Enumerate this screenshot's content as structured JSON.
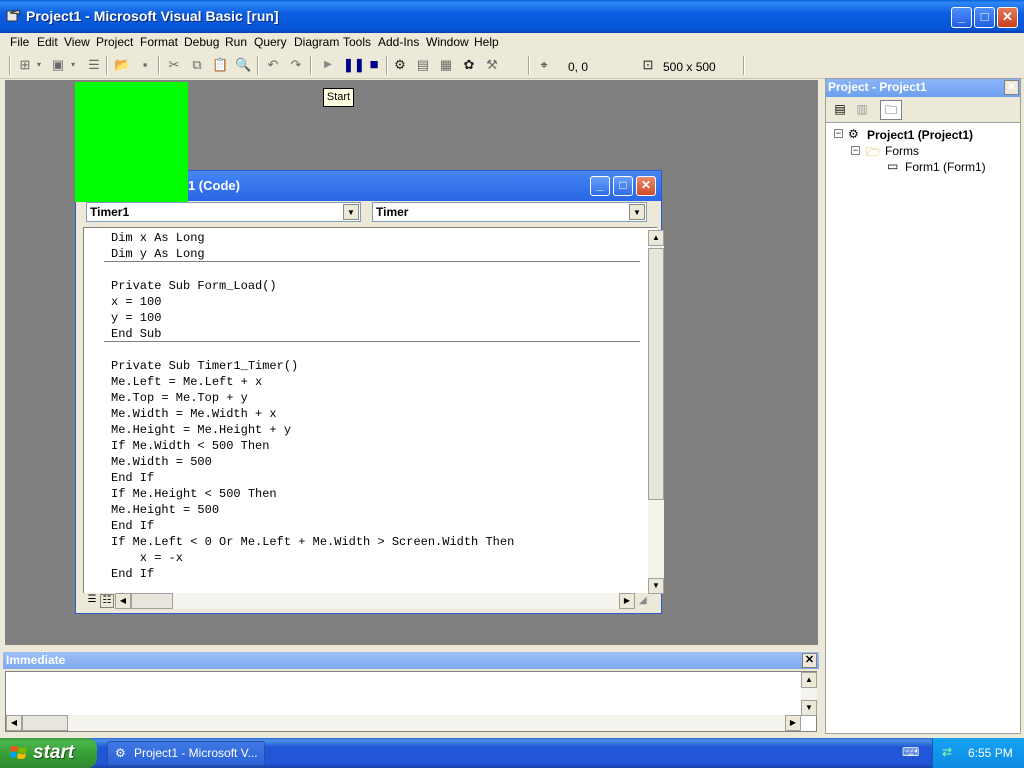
{
  "window": {
    "title": "Project1 - Microsoft Visual Basic [run]"
  },
  "menu": [
    "File",
    "Edit",
    "View",
    "Project",
    "Format",
    "Debug",
    "Run",
    "Query",
    "Diagram",
    "Tools",
    "Add-Ins",
    "Window",
    "Help"
  ],
  "toolbar": {
    "position": "0, 0",
    "size": "500 x 500"
  },
  "tooltip": "Start",
  "code_window": {
    "title": "n1 (Code)",
    "object_combo": "Timer1",
    "proc_combo": "Timer",
    "code": [
      "Dim x As Long\nDim y As Long",
      "Private Sub Form_Load()\nx = 100\ny = 100\nEnd Sub",
      "Private Sub Timer1_Timer()\nMe.Left = Me.Left + x\nMe.Top = Me.Top + y\nMe.Width = Me.Width + x\nMe.Height = Me.Height + y\nIf Me.Width < 500 Then\nMe.Width = 500\nEnd If\nIf Me.Height < 500 Then\nMe.Height = 500\nEnd If\nIf Me.Left < 0 Or Me.Left + Me.Width > Screen.Width Then\n    x = -x\nEnd If"
    ]
  },
  "project_panel": {
    "title": "Project - Project1",
    "root": "Project1 (Project1)",
    "folder": "Forms",
    "form": "Form1 (Form1)"
  },
  "immediate": {
    "title": "Immediate"
  },
  "taskbar": {
    "start_label": "start",
    "task_label": "Project1 - Microsoft V...",
    "clock": "6:55 PM"
  },
  "colors": {
    "running_form": "#00ff00",
    "mdi_background": "#808080"
  }
}
